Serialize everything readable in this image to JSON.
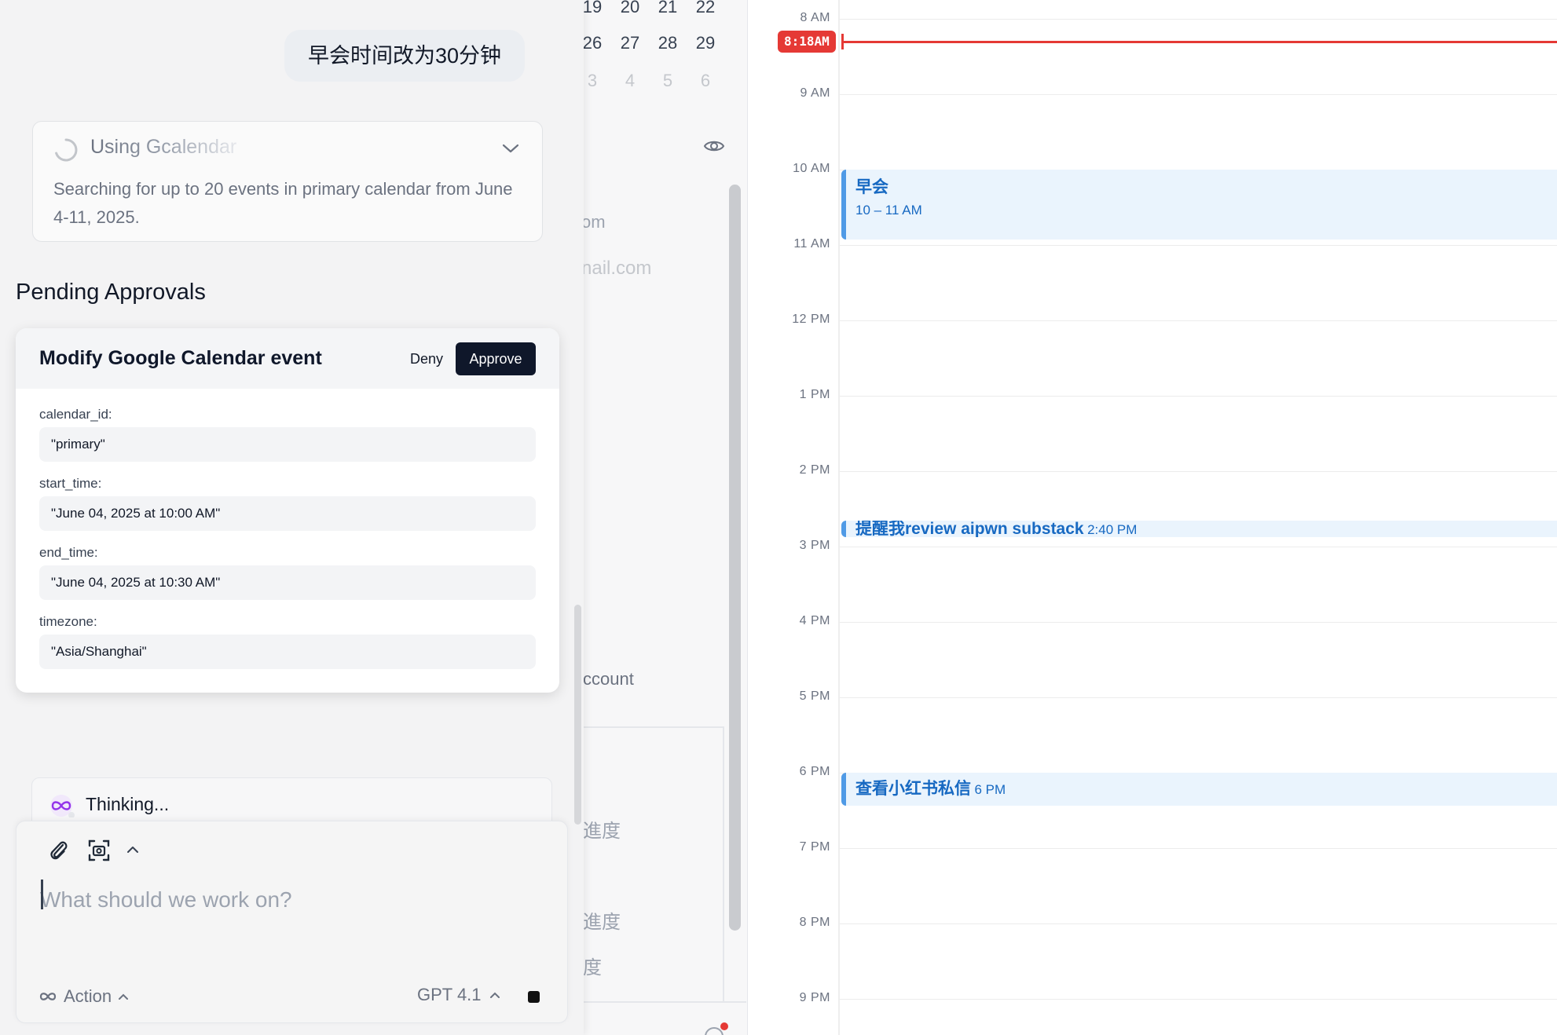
{
  "chat": {
    "user_message": "早会时间改为30分钟",
    "tool_call": {
      "title": "Using Gcalendar",
      "description": "Searching for up to 20 events in primary calendar from June 4-11, 2025."
    },
    "pending_heading": "Pending Approvals",
    "approval": {
      "title": "Modify Google Calendar event",
      "deny_label": "Deny",
      "approve_label": "Approve",
      "params": [
        {
          "label": "calendar_id:",
          "value": "\"primary\""
        },
        {
          "label": "start_time:",
          "value": "\"June 04, 2025 at 10:00 AM\""
        },
        {
          "label": "end_time:",
          "value": "\"June 04, 2025 at 10:30 AM\""
        },
        {
          "label": "timezone:",
          "value": "\"Asia/Shanghai\""
        }
      ]
    },
    "thinking_label": "Thinking...",
    "composer": {
      "placeholder": "What should we work on?",
      "mode_label": "Action",
      "model_label": "GPT 4.1"
    }
  },
  "sidebar_partial": {
    "mini_calendar_rows": [
      [
        "19",
        "20",
        "21",
        "22"
      ],
      [
        "26",
        "27",
        "28",
        "29"
      ],
      [
        "3",
        "4",
        "5",
        "6"
      ]
    ],
    "text_fragments": [
      "om",
      "nail.com",
      "ccount",
      "進度",
      "進度",
      "度"
    ]
  },
  "calendar": {
    "now_label": "8:18AM",
    "hours": [
      "8 AM",
      "9 AM",
      "10 AM",
      "11 AM",
      "12 PM",
      "1 PM",
      "2 PM",
      "3 PM",
      "4 PM",
      "5 PM",
      "6 PM",
      "7 PM",
      "8 PM",
      "9 PM"
    ],
    "events": [
      {
        "title": "早会",
        "time": "10 – 11 AM"
      },
      {
        "title": "提醒我review aipwn substack",
        "time": "2:40 PM"
      },
      {
        "title": "查看小红书私信",
        "time": "6 PM"
      }
    ]
  },
  "colors": {
    "accent_now": "#e53935",
    "event_bg": "#eaf4fd",
    "event_text": "#1769c2",
    "approve_bg": "#0f172a"
  }
}
